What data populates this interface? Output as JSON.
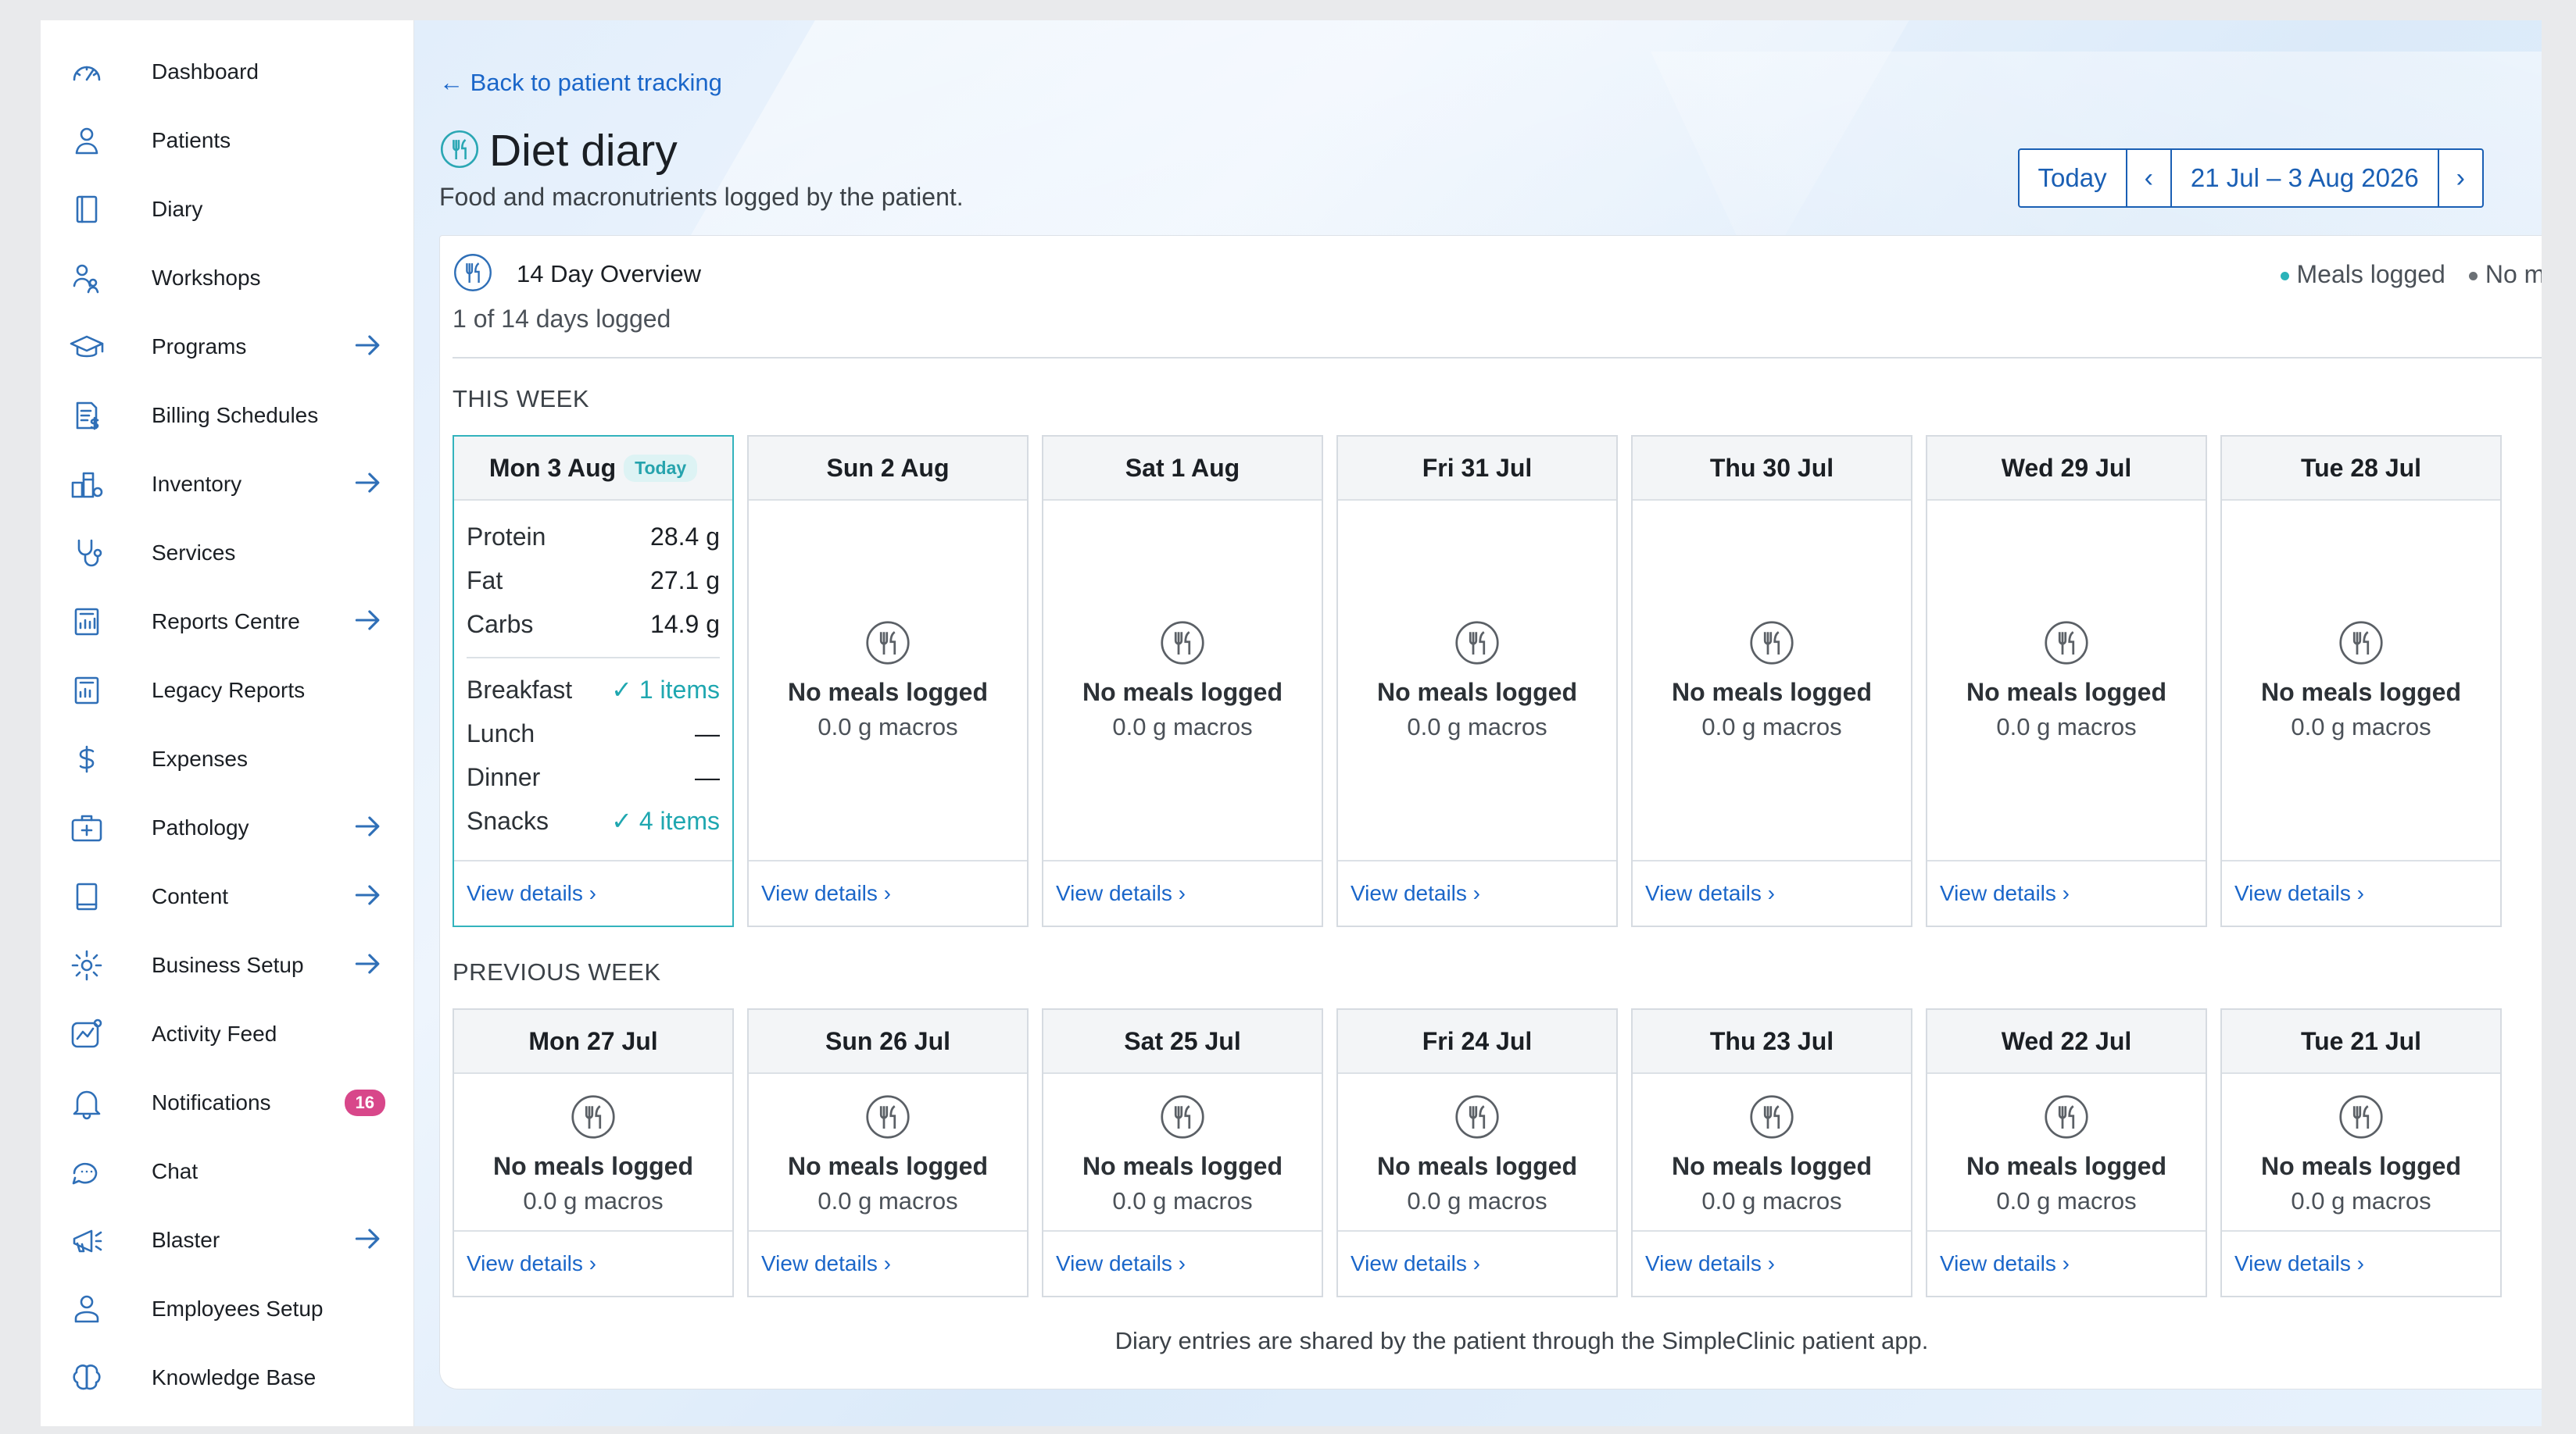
{
  "sidebar": {
    "items": [
      {
        "label": "Dashboard",
        "icon": "gauge-icon",
        "arrow": false
      },
      {
        "label": "Patients",
        "icon": "user-icon",
        "arrow": false
      },
      {
        "label": "Diary",
        "icon": "book-icon",
        "arrow": false
      },
      {
        "label": "Workshops",
        "icon": "group-icon",
        "arrow": false
      },
      {
        "label": "Programs",
        "icon": "graduation-cap-icon",
        "arrow": true
      },
      {
        "label": "Billing Schedules",
        "icon": "billing-icon",
        "arrow": false
      },
      {
        "label": "Inventory",
        "icon": "inventory-icon",
        "arrow": true
      },
      {
        "label": "Services",
        "icon": "stethoscope-icon",
        "arrow": false
      },
      {
        "label": "Reports Centre",
        "icon": "report-icon",
        "arrow": true
      },
      {
        "label": "Legacy Reports",
        "icon": "legacy-report-icon",
        "arrow": false
      },
      {
        "label": "Expenses",
        "icon": "dollar-icon",
        "arrow": false
      },
      {
        "label": "Pathology",
        "icon": "medical-kit-icon",
        "arrow": true
      },
      {
        "label": "Content",
        "icon": "content-book-icon",
        "arrow": true
      },
      {
        "label": "Business Setup",
        "icon": "gear-icon",
        "arrow": true
      },
      {
        "label": "Activity Feed",
        "icon": "activity-icon",
        "arrow": false
      },
      {
        "label": "Notifications",
        "icon": "bell-icon",
        "arrow": false,
        "badge": "16"
      },
      {
        "label": "Chat",
        "icon": "chat-icon",
        "arrow": false
      },
      {
        "label": "Blaster",
        "icon": "megaphone-icon",
        "arrow": true
      },
      {
        "label": "Employees Setup",
        "icon": "employee-icon",
        "arrow": false
      },
      {
        "label": "Knowledge Base",
        "icon": "brain-icon",
        "arrow": false
      }
    ]
  },
  "header": {
    "back_link": "← Back to patient tracking",
    "title": "Diet diary",
    "subtitle": "Food and macronutrients logged by the patient.",
    "today_button": "Today",
    "prev_button": "‹",
    "next_button": "›",
    "date_range": "21 Jul – 3 Aug 2026"
  },
  "overview": {
    "title": "14 Day Overview",
    "summary": "1 of 14 days logged",
    "legend_logged": "Meals logged",
    "legend_none": "No meals",
    "colors": {
      "logged": "#2ab3b9",
      "none": "#6b7075",
      "accent": "#1a5fb4"
    }
  },
  "labels": {
    "no_meals": "No meals logged",
    "macros": "0.0 g macros",
    "view_details": "View details ›",
    "today_badge": "Today"
  },
  "this_week": {
    "label": "THIS WEEK",
    "today": {
      "day": "Mon 3 Aug",
      "macros": [
        {
          "name": "Protein",
          "value": "28.4 g"
        },
        {
          "name": "Fat",
          "value": "27.1 g"
        },
        {
          "name": "Carbs",
          "value": "14.9 g"
        }
      ],
      "meals": [
        {
          "name": "Breakfast",
          "value": "✓ 1 items",
          "ok": true
        },
        {
          "name": "Lunch",
          "value": "—",
          "ok": false
        },
        {
          "name": "Dinner",
          "value": "—",
          "ok": false
        },
        {
          "name": "Snacks",
          "value": "✓ 4 items",
          "ok": true
        }
      ]
    },
    "days": [
      "Sun 2 Aug",
      "Sat 1 Aug",
      "Fri 31 Jul",
      "Thu 30 Jul",
      "Wed 29 Jul",
      "Tue 28 Jul"
    ]
  },
  "previous_week": {
    "label": "PREVIOUS WEEK",
    "days": [
      "Mon 27 Jul",
      "Sun 26 Jul",
      "Sat 25 Jul",
      "Fri 24 Jul",
      "Thu 23 Jul",
      "Wed 22 Jul",
      "Tue 21 Jul"
    ]
  },
  "footer": "Diary entries are shared by the patient through the SimpleClinic patient app."
}
